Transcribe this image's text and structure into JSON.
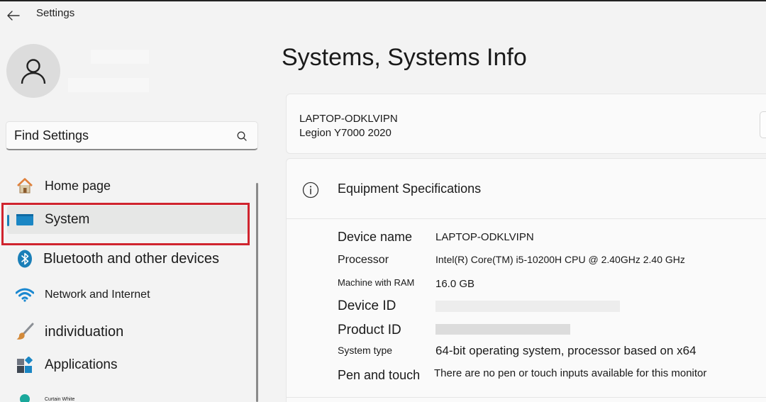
{
  "window": {
    "title": "Settings"
  },
  "sidebar": {
    "search": {
      "placeholder": "Find Settings"
    },
    "items": [
      {
        "label": "Home page"
      },
      {
        "label": "System"
      },
      {
        "label": "Bluetooth and other devices"
      },
      {
        "label": "Network and Internet"
      },
      {
        "label": "individuation"
      },
      {
        "label": "Applications"
      },
      {
        "label": "Curtain White"
      }
    ]
  },
  "main": {
    "page_title": "Systems, Systems Info",
    "device": {
      "hostname": "LAPTOP-ODKLVIPN",
      "model": "Legion Y7000 2020"
    },
    "specs": {
      "title": "Equipment Specifications",
      "rows": [
        {
          "label": "Device name",
          "value": "LAPTOP-ODKLVIPN"
        },
        {
          "label": "Processor",
          "value": "Intel(R) Core(TM) i5-10200H CPU @ 2.40GHz 2.40 GHz"
        },
        {
          "label": "Machine with RAM",
          "value": "16.0 GB"
        },
        {
          "label": "Device ID",
          "value": ""
        },
        {
          "label": "Product ID",
          "value": ""
        },
        {
          "label": "System type",
          "value": "64-bit operating system, processor based on x64"
        },
        {
          "label": "Pen and touch",
          "value": "There are no pen or touch inputs available for this monitor"
        }
      ]
    }
  },
  "colors": {
    "accent": "#1a7fb8",
    "highlight": "#d0242e",
    "background": "#f3f3f3"
  }
}
